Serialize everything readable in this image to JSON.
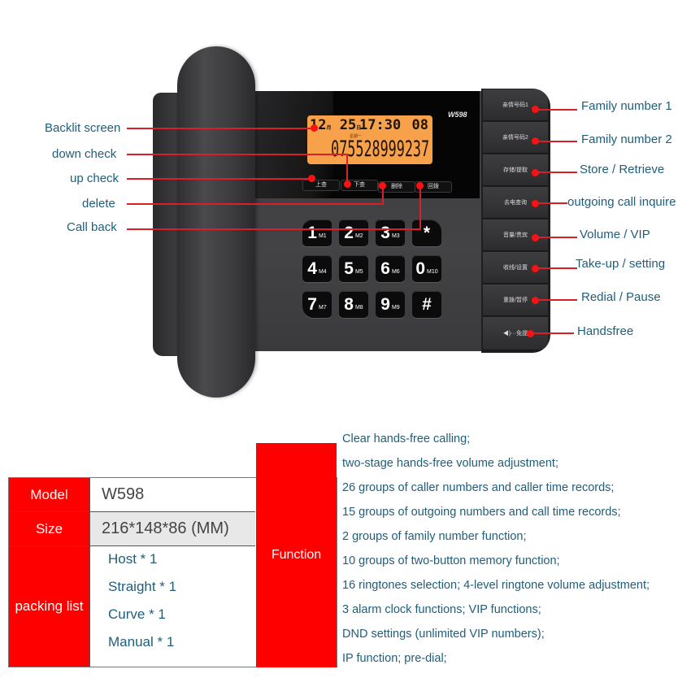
{
  "phone": {
    "model_logo": "W598",
    "lcd": {
      "date_month": "12",
      "date_day": "25",
      "time": "17:30",
      "count": "08",
      "weekday": "星期一",
      "number": "075528999237"
    },
    "function_keys": [
      "上查",
      "下查",
      "删除",
      "回拨"
    ],
    "keypad": [
      {
        "digit": "1",
        "mem": "M1"
      },
      {
        "digit": "2",
        "mem": "M2"
      },
      {
        "digit": "3",
        "mem": "M3"
      },
      {
        "digit": "*",
        "mem": ""
      },
      {
        "digit": "4",
        "mem": "M4"
      },
      {
        "digit": "5",
        "mem": "M5"
      },
      {
        "digit": "6",
        "mem": "M6"
      },
      {
        "digit": "0",
        "mem": "M10"
      },
      {
        "digit": "7",
        "mem": "M7"
      },
      {
        "digit": "8",
        "mem": "M8"
      },
      {
        "digit": "9",
        "mem": "M9"
      },
      {
        "digit": "#",
        "mem": ""
      }
    ],
    "side_buttons": [
      "亲情号码1",
      "亲情号码2",
      "存储/提取",
      "去电查询",
      "音量/贵宾",
      "收线/设置",
      "重拨/暂停",
      "◀)···免提"
    ]
  },
  "callouts_left": [
    "Backlit screen",
    "down check",
    "up check",
    "delete",
    "Call back"
  ],
  "callouts_right": [
    "Family number 1",
    "Family number 2",
    "Store / Retrieve",
    "outgoing call inquire",
    "Volume / VIP",
    "Take-up / setting",
    "Redial / Pause",
    "Handsfree"
  ],
  "specs": {
    "model_label": "Model",
    "model_value": "W598",
    "size_label": "Size",
    "size_value": "216*148*86 (MM)",
    "packing_label": "packing list",
    "packing_items": [
      "Host * 1",
      "Straight * 1",
      "Curve * 1",
      "Manual * 1"
    ],
    "function_label": "Function",
    "functions": [
      "Clear hands-free calling;",
      "two-stage hands-free volume adjustment;",
      "26 groups of caller numbers and caller time records;",
      "15 groups of outgoing numbers and call time records;",
      "2 groups of family number function;",
      "10 groups of two-button memory function;",
      "16 ringtones selection; 4-level ringtone volume adjustment;",
      "3 alarm clock functions; VIP functions;",
      "DND settings (unlimited VIP numbers);",
      "IP function; pre-dial;"
    ]
  },
  "colors": {
    "accent_red": "#ff0000",
    "callout_line": "#d9202a",
    "label_text": "#1f5e7a",
    "lcd_backlight": "#f7a24a"
  }
}
